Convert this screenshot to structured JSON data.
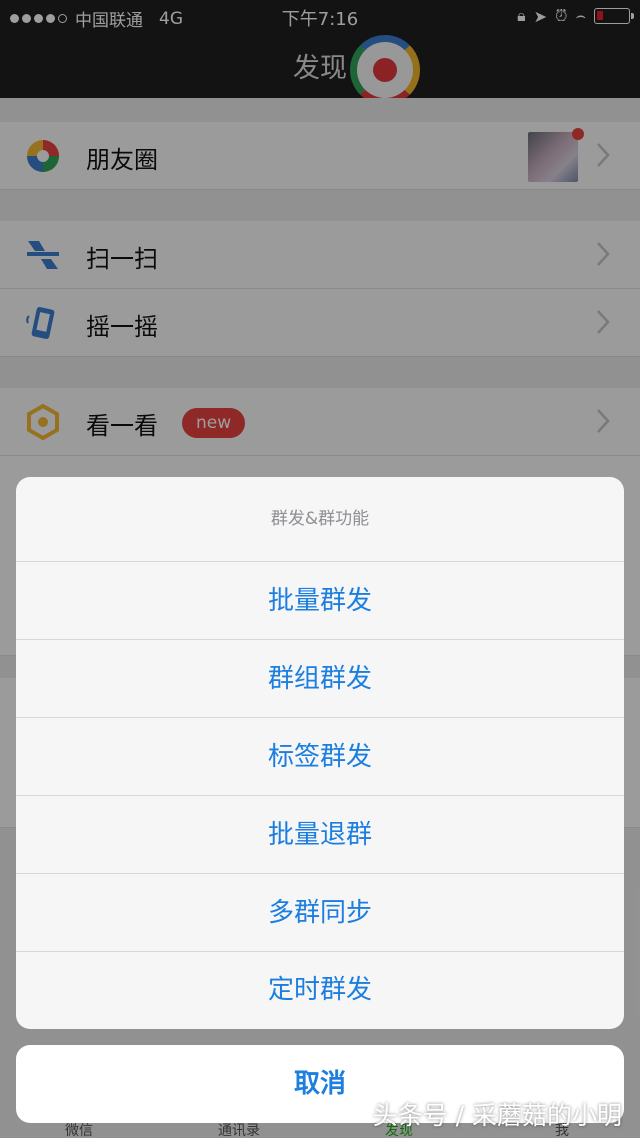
{
  "status_bar": {
    "carrier": "中国联通",
    "network": "4G",
    "time": "下午7:16"
  },
  "nav": {
    "title": "发现"
  },
  "page": {
    "items": [
      {
        "label": "朋友圈"
      },
      {
        "label": "扫一扫"
      },
      {
        "label": "摇一摇"
      },
      {
        "label": "看一看",
        "badge": "new"
      }
    ]
  },
  "action_sheet": {
    "title": "群发&群功能",
    "items": [
      "批量群发",
      "群组群发",
      "标签群发",
      "批量退群",
      "多群同步",
      "定时群发"
    ],
    "cancel": "取消"
  },
  "tab_bar": {
    "tabs": [
      "微信",
      "通讯录",
      "发现",
      "我"
    ]
  },
  "watermark": "头条号 / 采蘑菇的小明",
  "colors": {
    "accent": "#1b7ee0",
    "badge": "#e64340",
    "nav_background": "#1f1f20"
  }
}
